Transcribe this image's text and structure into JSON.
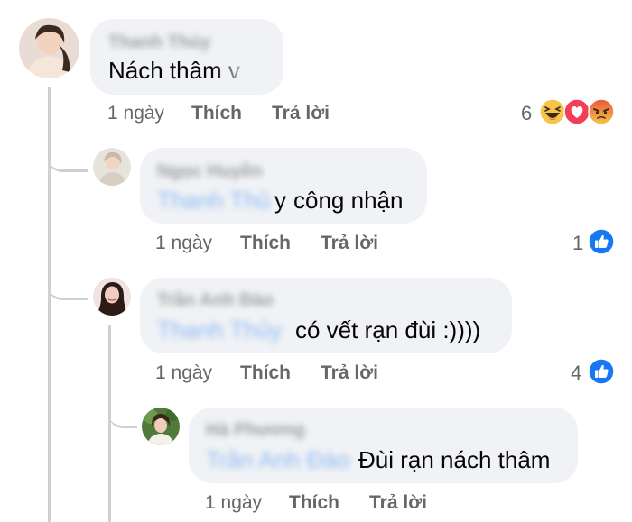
{
  "comments": [
    {
      "author": "Thanh Thủy",
      "text": "Nách thâm v",
      "time": "1 ngày",
      "like_label": "Thích",
      "reply_label": "Trả lời",
      "reaction_count": "6",
      "reactions": [
        "haha-icon",
        "love-icon",
        "angry-icon"
      ]
    },
    {
      "author": "Ngọc Huyền",
      "mention_prefix": "Thanh Thủ",
      "mention_suffix": "y",
      "text": "công nhận",
      "time": "1 ngày",
      "like_label": "Thích",
      "reply_label": "Trả lời",
      "reaction_count": "1",
      "reactions": [
        "like-icon"
      ]
    },
    {
      "author": "Trần Anh Đào",
      "mention": "Thanh Thủy",
      "text": "có vết rạn đùi :))))",
      "time": "1 ngày",
      "like_label": "Thích",
      "reply_label": "Trả lời",
      "reaction_count": "4",
      "reactions": [
        "like-icon"
      ]
    },
    {
      "author": "Hà Phương",
      "mention": "Trần Anh Đào",
      "text": "Đùi rạn nách thâm",
      "time": "1 ngày",
      "like_label": "Thích",
      "reply_label": "Trả lời"
    }
  ],
  "colors": {
    "bubble": "#f0f2f5",
    "meta": "#65676b",
    "mention": "#1877f2",
    "thread_line": "#ced0d4",
    "like_blue": "#1877f2"
  }
}
